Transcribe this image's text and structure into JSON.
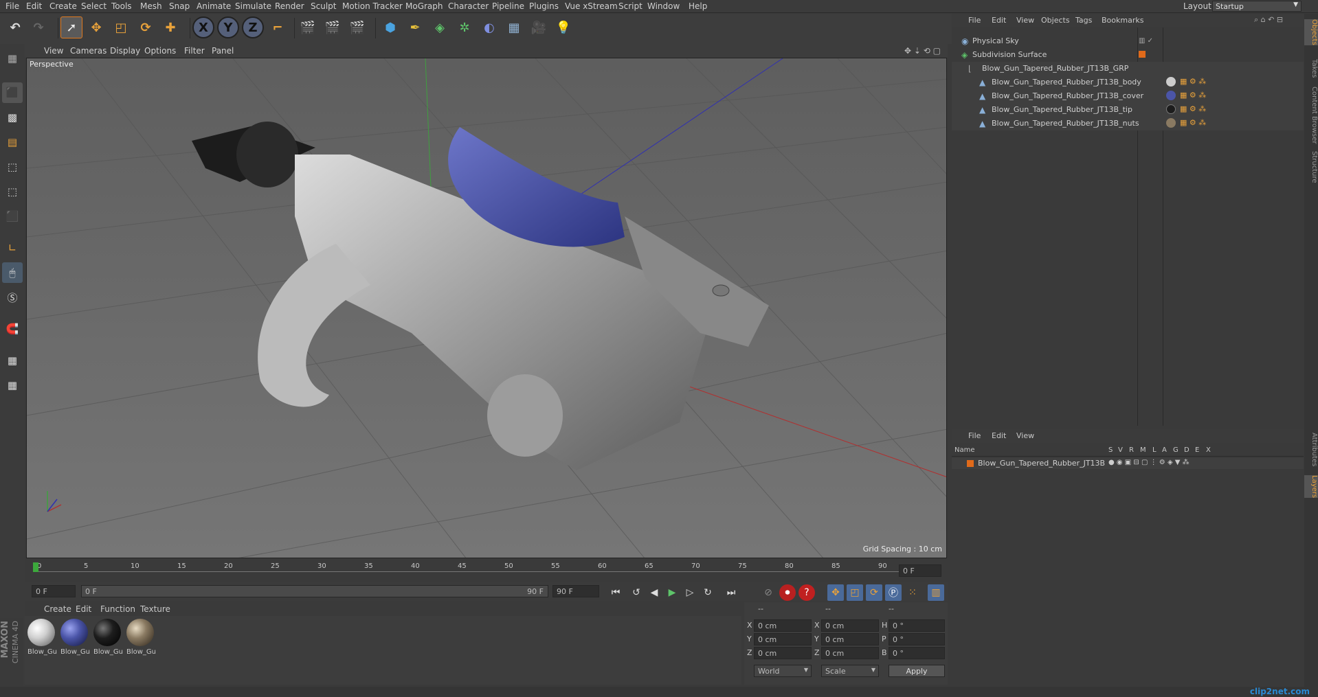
{
  "menu": [
    "File",
    "Edit",
    "Create",
    "Select",
    "Tools",
    "Mesh",
    "Snap",
    "Animate",
    "Simulate",
    "Render",
    "Sculpt",
    "Motion Tracker",
    "MoGraph",
    "Character",
    "Pipeline",
    "Plugins",
    "Vue xStream",
    "Script",
    "Window",
    "Help"
  ],
  "layout": {
    "label": "Layout:",
    "value": "Startup"
  },
  "toolbar": {
    "x": "X",
    "y": "Y",
    "z": "Z"
  },
  "viewport": {
    "menu": [
      "View",
      "Cameras",
      "Display",
      "Options",
      "Filter",
      "Panel"
    ],
    "label": "Perspective",
    "grid_spacing": "Grid Spacing : 10 cm"
  },
  "timeline": {
    "ticks": [
      "0",
      "5",
      "10",
      "15",
      "20",
      "25",
      "30",
      "35",
      "40",
      "45",
      "50",
      "55",
      "60",
      "65",
      "70",
      "75",
      "80",
      "85",
      "90"
    ],
    "current_frame": "0 F",
    "start": "0 F",
    "range_start": "0 F",
    "range_end": "90 F",
    "end": "90 F"
  },
  "material_manager": {
    "menu": [
      "Create",
      "Edit",
      "Function",
      "Texture"
    ],
    "materials": [
      {
        "name": "Blow_Gu",
        "color": "#cfcfcf"
      },
      {
        "name": "Blow_Gu",
        "color": "#4b55a8"
      },
      {
        "name": "Blow_Gu",
        "color": "#1d1d1d"
      },
      {
        "name": "Blow_Gu",
        "color": "#8a7a62"
      }
    ],
    "brand1": "MAXON",
    "brand2": "CINEMA 4D"
  },
  "coordinates": {
    "header": [
      "--",
      "--",
      "--"
    ],
    "rows": [
      {
        "a": "X",
        "av": "0 cm",
        "b": "X",
        "bv": "0 cm",
        "c": "H",
        "cv": "0 °"
      },
      {
        "a": "Y",
        "av": "0 cm",
        "b": "Y",
        "bv": "0 cm",
        "c": "P",
        "cv": "0 °"
      },
      {
        "a": "Z",
        "av": "0 cm",
        "b": "Z",
        "bv": "0 cm",
        "c": "B",
        "cv": "0 °"
      }
    ],
    "world": "World",
    "scale": "Scale",
    "apply": "Apply"
  },
  "object_manager": {
    "menu": [
      "File",
      "Edit",
      "View",
      "Objects",
      "Tags",
      "Bookmarks"
    ],
    "objects": [
      {
        "name": "Physical Sky",
        "indent": 0
      },
      {
        "name": "Subdivision Surface",
        "indent": 0
      },
      {
        "name": "Blow_Gun_Tapered_Rubber_JT13B_GRP",
        "indent": 1
      },
      {
        "name": "Blow_Gun_Tapered_Rubber_JT13B_body",
        "indent": 2
      },
      {
        "name": "Blow_Gun_Tapered_Rubber_JT13B_cover",
        "indent": 2
      },
      {
        "name": "Blow_Gun_Tapered_Rubber_JT13B_tip",
        "indent": 2
      },
      {
        "name": "Blow_Gun_Tapered_Rubber_JT13B_nuts",
        "indent": 2
      }
    ]
  },
  "layer_manager": {
    "menu": [
      "File",
      "Edit",
      "View"
    ],
    "columns": [
      "Name",
      "S",
      "V",
      "R",
      "M",
      "L",
      "A",
      "G",
      "D",
      "E",
      "X"
    ],
    "layers": [
      {
        "name": "Blow_Gun_Tapered_Rubber_JT13B"
      }
    ]
  },
  "side_tabs": [
    "Objects",
    "Takes",
    "Content Browser",
    "Structure",
    "Attributes",
    "Layers"
  ],
  "watermark": "clip2net.com"
}
